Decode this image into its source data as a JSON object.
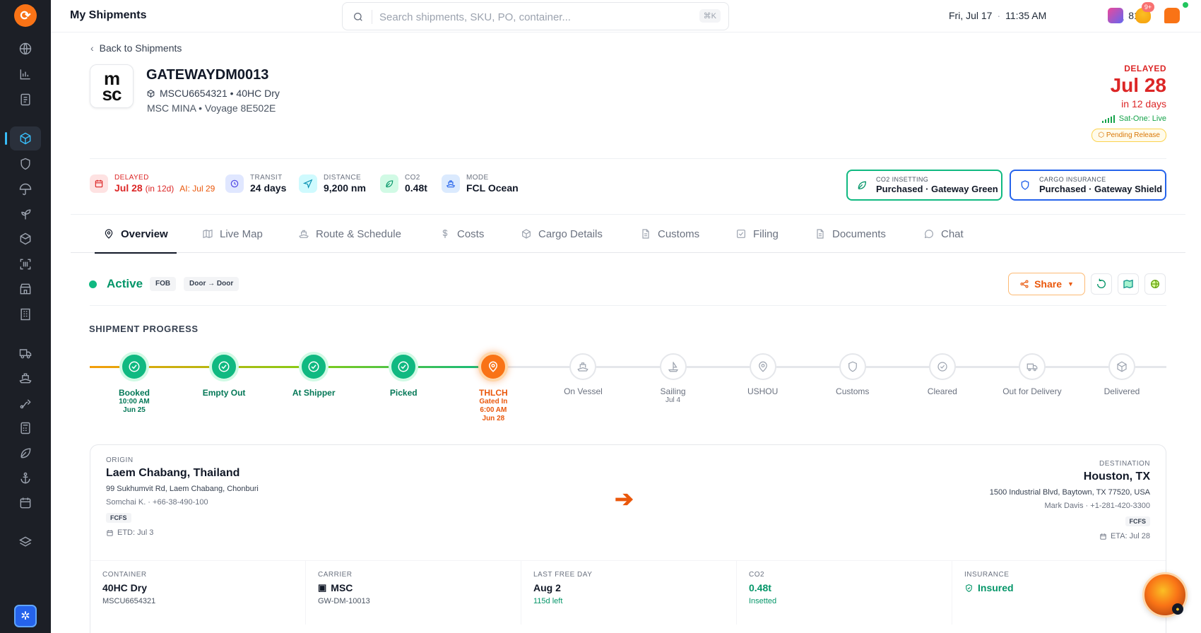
{
  "topbar": {
    "title": "My Shipments",
    "search_placeholder": "Search shipments, SKU, PO, container...",
    "search_shortcut": "⌘K",
    "date": "Fri, Jul 17",
    "time": "11:35 AM",
    "temperature": "81°",
    "notification_count": "9+"
  },
  "header": {
    "back_label": "Back to Shipments",
    "carrier_logo_text": [
      "m",
      "sc"
    ],
    "shipment_id": "GATEWAYDM0013",
    "container_line": "MSCU6654321 • 40HC Dry",
    "vessel_line": "MSC MINA • Voyage 8E502E",
    "status_label": "DELAYED",
    "eta_date": "Jul 28",
    "eta_relative": "in 12 days",
    "tracking": "Sat-One: Live",
    "release_badge": "Pending Release"
  },
  "stats": [
    {
      "label": "DELAYED",
      "value": "Jul 28",
      "extra": "(in 12d)",
      "ai": "AI: Jul 29"
    },
    {
      "label": "TRANSIT",
      "value": "24 days"
    },
    {
      "label": "DISTANCE",
      "value": "9,200 nm"
    },
    {
      "label": "CO2",
      "value": "0.48t"
    },
    {
      "label": "MODE",
      "value": "FCL Ocean"
    }
  ],
  "services": [
    {
      "label": "CO2 INSETTING",
      "value": "Purchased · Gateway Green",
      "color": "#10b981"
    },
    {
      "label": "CARGO INSURANCE",
      "value": "Purchased · Gateway Shield",
      "color": "#2563eb"
    }
  ],
  "tabs": [
    "Overview",
    "Live Map",
    "Route & Schedule",
    "Costs",
    "Cargo Details",
    "Customs",
    "Filing",
    "Documents",
    "Chat"
  ],
  "status": {
    "state": "Active",
    "incoterm": "FOB",
    "service": "Door → Door",
    "share_label": "Share"
  },
  "progress": {
    "title": "SHIPMENT PROGRESS",
    "steps": [
      {
        "name": "Booked",
        "sub": [
          "10:00 AM",
          "Jun 25"
        ],
        "state": "done"
      },
      {
        "name": "Empty Out",
        "sub": [],
        "state": "done"
      },
      {
        "name": "At Shipper",
        "sub": [],
        "state": "done"
      },
      {
        "name": "Picked",
        "sub": [],
        "state": "done"
      },
      {
        "name": "THLCH",
        "sub": [
          "Gated In",
          "6:00 AM",
          "Jun 28"
        ],
        "state": "current"
      },
      {
        "name": "On Vessel",
        "sub": [],
        "state": "future"
      },
      {
        "name": "Sailing",
        "sub": [
          "Jul 4"
        ],
        "state": "future"
      },
      {
        "name": "USHOU",
        "sub": [],
        "state": "future"
      },
      {
        "name": "Customs",
        "sub": [],
        "state": "future"
      },
      {
        "name": "Cleared",
        "sub": [],
        "state": "future"
      },
      {
        "name": "Out for Delivery",
        "sub": [],
        "state": "future"
      },
      {
        "name": "Delivered",
        "sub": [],
        "state": "future"
      }
    ]
  },
  "route": {
    "origin": {
      "label": "ORIGIN",
      "city": "Laem Chabang, Thailand",
      "address": "99 Sukhumvit Rd, Laem Chabang, Chonburi",
      "contact": "Somchai K. · +66-38-490-100",
      "tag": "FCFS",
      "date": "ETD: Jul 3"
    },
    "destination": {
      "label": "DESTINATION",
      "city": "Houston, TX",
      "address": "1500 Industrial Blvd, Baytown, TX 77520, USA",
      "contact": "Mark Davis · +1-281-420-3300",
      "tag": "FCFS",
      "date": "ETA: Jul 28"
    },
    "arrow": "➔"
  },
  "metrics": [
    {
      "label": "CONTAINER",
      "value": "40HC Dry",
      "sub": "MSCU6654321"
    },
    {
      "label": "CARRIER",
      "value": "MSC",
      "sub": "GW-DM-10013"
    },
    {
      "label": "LAST FREE DAY",
      "value": "Aug 2",
      "sub": "115d left"
    },
    {
      "label": "CO2",
      "value": "0.48t",
      "sub": "Insetted"
    },
    {
      "label": "INSURANCE",
      "value": "Insured",
      "sub": ""
    }
  ]
}
